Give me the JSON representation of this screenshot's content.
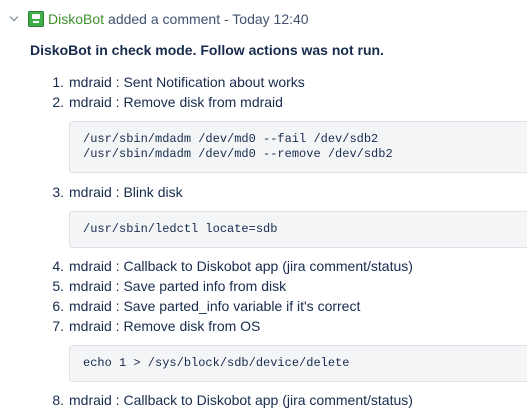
{
  "header": {
    "author": "DiskoBot",
    "action": "added a comment - Today 12:40"
  },
  "title": "DiskoBot in check mode. Follow actions was not run.",
  "steps": [
    {
      "num": "1.",
      "text": "mdraid : Sent Notification about works"
    },
    {
      "num": "2.",
      "text": "mdraid : Remove disk from mdraid",
      "code": [
        "/usr/sbin/mdadm /dev/md0 --fail /dev/sdb2",
        "/usr/sbin/mdadm /dev/md0 --remove /dev/sdb2"
      ]
    },
    {
      "num": "3.",
      "text": "mdraid : Blink disk",
      "code": [
        "/usr/sbin/ledctl locate=sdb"
      ]
    },
    {
      "num": "4.",
      "text": "mdraid : Callback to Diskobot app (jira comment/status)"
    },
    {
      "num": "5.",
      "text": "mdraid : Save parted info from disk"
    },
    {
      "num": "6.",
      "text": "mdraid : Save parted_info variable if it's correct"
    },
    {
      "num": "7.",
      "text": "mdraid : Remove disk from OS",
      "code": [
        "echo 1 > /sys/block/sdb/device/delete"
      ]
    },
    {
      "num": "8.",
      "text": "mdraid : Callback to Diskobot app (jira comment/status)"
    }
  ]
}
